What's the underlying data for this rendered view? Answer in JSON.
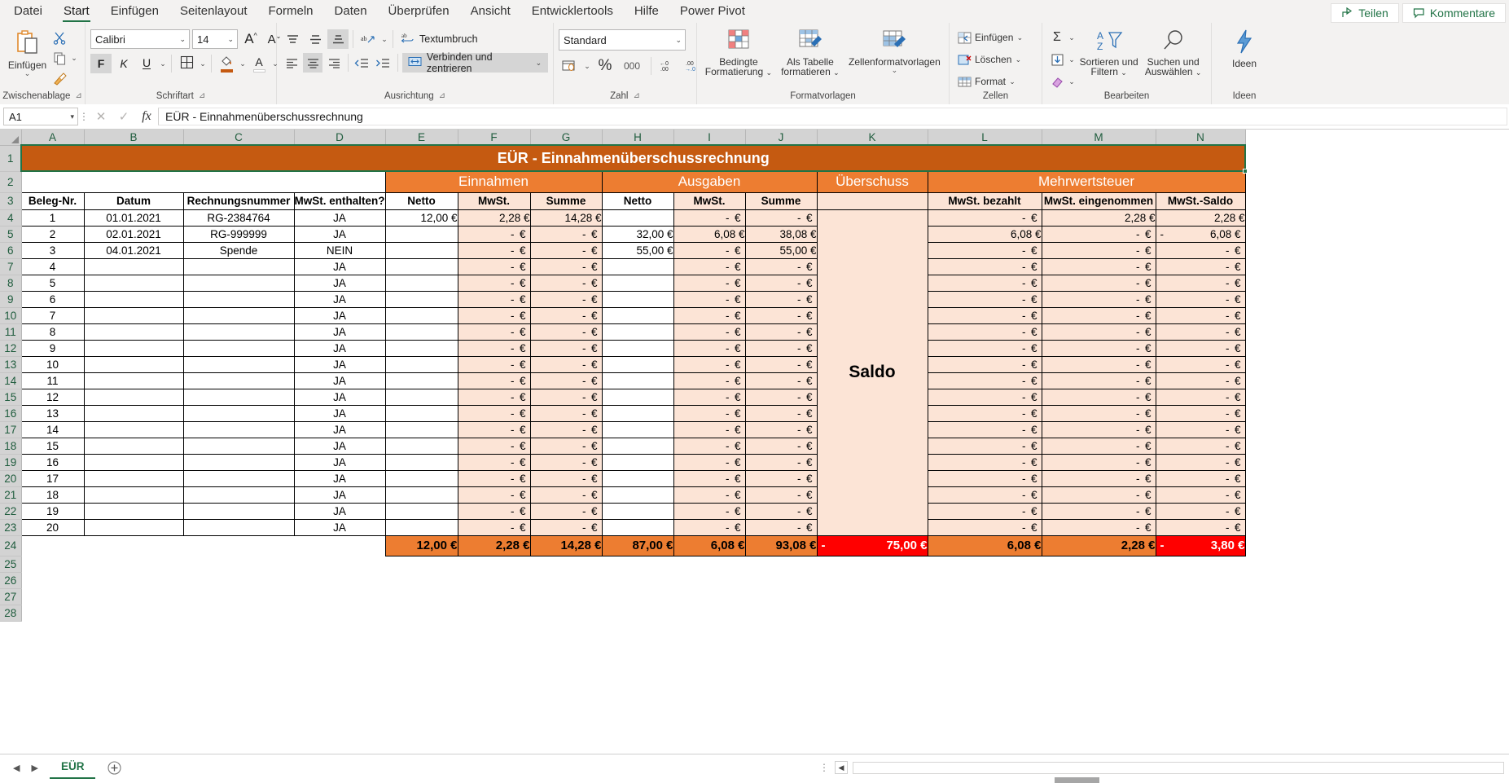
{
  "app": {
    "tabs": [
      "Datei",
      "Start",
      "Einfügen",
      "Seitenlayout",
      "Formeln",
      "Daten",
      "Überprüfen",
      "Ansicht",
      "Entwicklertools",
      "Hilfe",
      "Power Pivot"
    ],
    "active_tab": "Start",
    "share_label": "Teilen",
    "comment_label": "Kommentare"
  },
  "ribbon": {
    "clipboard": {
      "group_label": "Zwischenablage",
      "paste_label": "Einfügen",
      "cut_name": "cut-icon",
      "copy_name": "copy-icon",
      "format_painter_name": "format-painter-icon"
    },
    "font": {
      "group_label": "Schriftart",
      "font_family": "Calibri",
      "font_size": "14",
      "grow_label": "A",
      "shrink_label": "A",
      "bold_label": "F",
      "italic_label": "K",
      "underline_label": "U",
      "font_color": "#ffffff",
      "fill_color": "#c55a11"
    },
    "alignment": {
      "group_label": "Ausrichtung",
      "wrap_label": "Textumbruch",
      "merge_label": "Verbinden und zentrieren"
    },
    "number": {
      "group_label": "Zahl",
      "format": "Standard",
      "percent_label": "%",
      "thousands_label": "000"
    },
    "styles": {
      "group_label": "Formatvorlagen",
      "conditional_label": "Bedingte\nFormatierung",
      "conditional_line1": "Bedingte",
      "conditional_line2": "Formatierung",
      "table_line1": "Als Tabelle",
      "table_line2": "formatieren",
      "cellstyles_label": "Zellenformatvorlagen"
    },
    "cells": {
      "group_label": "Zellen",
      "insert_label": "Einfügen",
      "delete_label": "Löschen",
      "format_label": "Format"
    },
    "editing": {
      "group_label": "Bearbeiten",
      "autosum_name": "sigma-icon",
      "fill_name": "fill-down-icon",
      "clear_name": "eraser-icon",
      "sort_line1": "Sortieren und",
      "sort_line2": "Filtern",
      "find_line1": "Suchen und",
      "find_line2": "Auswählen"
    },
    "ideas": {
      "group_label": "Ideen",
      "button_label": "Ideen"
    }
  },
  "formula_bar": {
    "name_box": "A1",
    "value": "EÜR - Einnahmenüberschussrechnung",
    "cancel_name": "cancel-icon",
    "confirm_name": "confirm-icon",
    "fx_label": "fx"
  },
  "sheet": {
    "column_headers": [
      "A",
      "B",
      "C",
      "D",
      "E",
      "F",
      "G",
      "H",
      "I",
      "J",
      "K",
      "L",
      "M",
      "N"
    ],
    "row_numbers": [
      "1",
      "2",
      "3",
      "4",
      "5",
      "6",
      "7",
      "8",
      "9",
      "10",
      "11",
      "12",
      "13",
      "14",
      "15",
      "16",
      "17",
      "18",
      "19",
      "20",
      "21",
      "22",
      "23",
      "24",
      "25",
      "26",
      "27",
      "28"
    ],
    "title": "EÜR - Einnahmenüberschussrechnung",
    "group_headers": {
      "einnahmen": "Einnahmen",
      "ausgaben": "Ausgaben",
      "ueberschuss": "Überschuss",
      "mehrwertsteuer": "Mehrwertsteuer"
    },
    "column_labels": {
      "beleg_nr": "Beleg-Nr.",
      "datum": "Datum",
      "rechnungsnummer": "Rechnungsnummer",
      "mwst_enthalten": "MwSt. enthalten?",
      "e_netto": "Netto",
      "e_mwst": "MwSt.",
      "e_summe": "Summe",
      "a_netto": "Netto",
      "a_mwst": "MwSt.",
      "a_summe": "Summe",
      "mwst_bezahlt": "MwSt. bezahlt",
      "mwst_eingenommen": "MwSt. eingenommen",
      "mwst_saldo": "MwSt.-Saldo"
    },
    "saldo_label": "Saldo",
    "empty_euro": "-   €",
    "rows": [
      {
        "nr": "1",
        "datum": "01.01.2021",
        "rechnung": "RG-2384764",
        "mwst": "JA",
        "e_netto": "12,00 €",
        "e_mwst": "2,28 €",
        "e_summe": "14,28 €",
        "a_netto": "",
        "a_mwst": "-   €",
        "a_summe": "-   €",
        "bezahlt": "-   €",
        "eingenommen": "2,28 €",
        "saldo": "2,28 €",
        "saldo_neg": false
      },
      {
        "nr": "2",
        "datum": "02.01.2021",
        "rechnung": "RG-999999",
        "mwst": "JA",
        "e_netto": "",
        "e_mwst": "-   €",
        "e_summe": "-   €",
        "a_netto": "32,00 €",
        "a_mwst": "6,08 €",
        "a_summe": "38,08 €",
        "bezahlt": "6,08 €",
        "eingenommen": "-   €",
        "saldo": "6,08 €",
        "saldo_neg": true
      },
      {
        "nr": "3",
        "datum": "04.01.2021",
        "rechnung": "Spende",
        "mwst": "NEIN",
        "e_netto": "",
        "e_mwst": "-   €",
        "e_summe": "-   €",
        "a_netto": "55,00 €",
        "a_mwst": "-   €",
        "a_summe": "55,00 €",
        "bezahlt": "-   €",
        "eingenommen": "-   €",
        "saldo": "-   €",
        "saldo_neg": false
      },
      {
        "nr": "4",
        "datum": "",
        "rechnung": "",
        "mwst": "JA",
        "e_netto": "",
        "e_mwst": "-   €",
        "e_summe": "-   €",
        "a_netto": "",
        "a_mwst": "-   €",
        "a_summe": "-   €",
        "bezahlt": "-   €",
        "eingenommen": "-   €",
        "saldo": "-   €",
        "saldo_neg": false
      },
      {
        "nr": "5",
        "datum": "",
        "rechnung": "",
        "mwst": "JA",
        "e_netto": "",
        "e_mwst": "-   €",
        "e_summe": "-   €",
        "a_netto": "",
        "a_mwst": "-   €",
        "a_summe": "-   €",
        "bezahlt": "-   €",
        "eingenommen": "-   €",
        "saldo": "-   €",
        "saldo_neg": false
      },
      {
        "nr": "6",
        "datum": "",
        "rechnung": "",
        "mwst": "JA",
        "e_netto": "",
        "e_mwst": "-   €",
        "e_summe": "-   €",
        "a_netto": "",
        "a_mwst": "-   €",
        "a_summe": "-   €",
        "bezahlt": "-   €",
        "eingenommen": "-   €",
        "saldo": "-   €",
        "saldo_neg": false
      },
      {
        "nr": "7",
        "datum": "",
        "rechnung": "",
        "mwst": "JA",
        "e_netto": "",
        "e_mwst": "-   €",
        "e_summe": "-   €",
        "a_netto": "",
        "a_mwst": "-   €",
        "a_summe": "-   €",
        "bezahlt": "-   €",
        "eingenommen": "-   €",
        "saldo": "-   €",
        "saldo_neg": false
      },
      {
        "nr": "8",
        "datum": "",
        "rechnung": "",
        "mwst": "JA",
        "e_netto": "",
        "e_mwst": "-   €",
        "e_summe": "-   €",
        "a_netto": "",
        "a_mwst": "-   €",
        "a_summe": "-   €",
        "bezahlt": "-   €",
        "eingenommen": "-   €",
        "saldo": "-   €",
        "saldo_neg": false
      },
      {
        "nr": "9",
        "datum": "",
        "rechnung": "",
        "mwst": "JA",
        "e_netto": "",
        "e_mwst": "-   €",
        "e_summe": "-   €",
        "a_netto": "",
        "a_mwst": "-   €",
        "a_summe": "-   €",
        "bezahlt": "-   €",
        "eingenommen": "-   €",
        "saldo": "-   €",
        "saldo_neg": false
      },
      {
        "nr": "10",
        "datum": "",
        "rechnung": "",
        "mwst": "JA",
        "e_netto": "",
        "e_mwst": "-   €",
        "e_summe": "-   €",
        "a_netto": "",
        "a_mwst": "-   €",
        "a_summe": "-   €",
        "bezahlt": "-   €",
        "eingenommen": "-   €",
        "saldo": "-   €",
        "saldo_neg": false
      },
      {
        "nr": "11",
        "datum": "",
        "rechnung": "",
        "mwst": "JA",
        "e_netto": "",
        "e_mwst": "-   €",
        "e_summe": "-   €",
        "a_netto": "",
        "a_mwst": "-   €",
        "a_summe": "-   €",
        "bezahlt": "-   €",
        "eingenommen": "-   €",
        "saldo": "-   €",
        "saldo_neg": false
      },
      {
        "nr": "12",
        "datum": "",
        "rechnung": "",
        "mwst": "JA",
        "e_netto": "",
        "e_mwst": "-   €",
        "e_summe": "-   €",
        "a_netto": "",
        "a_mwst": "-   €",
        "a_summe": "-   €",
        "bezahlt": "-   €",
        "eingenommen": "-   €",
        "saldo": "-   €",
        "saldo_neg": false
      },
      {
        "nr": "13",
        "datum": "",
        "rechnung": "",
        "mwst": "JA",
        "e_netto": "",
        "e_mwst": "-   €",
        "e_summe": "-   €",
        "a_netto": "",
        "a_mwst": "-   €",
        "a_summe": "-   €",
        "bezahlt": "-   €",
        "eingenommen": "-   €",
        "saldo": "-   €",
        "saldo_neg": false
      },
      {
        "nr": "14",
        "datum": "",
        "rechnung": "",
        "mwst": "JA",
        "e_netto": "",
        "e_mwst": "-   €",
        "e_summe": "-   €",
        "a_netto": "",
        "a_mwst": "-   €",
        "a_summe": "-   €",
        "bezahlt": "-   €",
        "eingenommen": "-   €",
        "saldo": "-   €",
        "saldo_neg": false
      },
      {
        "nr": "15",
        "datum": "",
        "rechnung": "",
        "mwst": "JA",
        "e_netto": "",
        "e_mwst": "-   €",
        "e_summe": "-   €",
        "a_netto": "",
        "a_mwst": "-   €",
        "a_summe": "-   €",
        "bezahlt": "-   €",
        "eingenommen": "-   €",
        "saldo": "-   €",
        "saldo_neg": false
      },
      {
        "nr": "16",
        "datum": "",
        "rechnung": "",
        "mwst": "JA",
        "e_netto": "",
        "e_mwst": "-   €",
        "e_summe": "-   €",
        "a_netto": "",
        "a_mwst": "-   €",
        "a_summe": "-   €",
        "bezahlt": "-   €",
        "eingenommen": "-   €",
        "saldo": "-   €",
        "saldo_neg": false
      },
      {
        "nr": "17",
        "datum": "",
        "rechnung": "",
        "mwst": "JA",
        "e_netto": "",
        "e_mwst": "-   €",
        "e_summe": "-   €",
        "a_netto": "",
        "a_mwst": "-   €",
        "a_summe": "-   €",
        "bezahlt": "-   €",
        "eingenommen": "-   €",
        "saldo": "-   €",
        "saldo_neg": false
      },
      {
        "nr": "18",
        "datum": "",
        "rechnung": "",
        "mwst": "JA",
        "e_netto": "",
        "e_mwst": "-   €",
        "e_summe": "-   €",
        "a_netto": "",
        "a_mwst": "-   €",
        "a_summe": "-   €",
        "bezahlt": "-   €",
        "eingenommen": "-   €",
        "saldo": "-   €",
        "saldo_neg": false
      },
      {
        "nr": "19",
        "datum": "",
        "rechnung": "",
        "mwst": "JA",
        "e_netto": "",
        "e_mwst": "-   €",
        "e_summe": "-   €",
        "a_netto": "",
        "a_mwst": "-   €",
        "a_summe": "-   €",
        "bezahlt": "-   €",
        "eingenommen": "-   €",
        "saldo": "-   €",
        "saldo_neg": false
      },
      {
        "nr": "20",
        "datum": "",
        "rechnung": "",
        "mwst": "JA",
        "e_netto": "",
        "e_mwst": "-   €",
        "e_summe": "-   €",
        "a_netto": "",
        "a_mwst": "-   €",
        "a_summe": "-   €",
        "bezahlt": "-   €",
        "eingenommen": "-   €",
        "saldo": "-   €",
        "saldo_neg": false
      }
    ],
    "totals": {
      "e_netto": "12,00 €",
      "e_mwst": "2,28 €",
      "e_summe": "14,28 €",
      "a_netto": "87,00 €",
      "a_mwst": "6,08 €",
      "a_summe": "93,08 €",
      "ueberschuss": "75,00 €",
      "ueberschuss_sign": "-",
      "bezahlt": "6,08 €",
      "eingenommen": "2,28 €",
      "mwst_saldo": "3,80 €",
      "mwst_saldo_sign": "-"
    },
    "selected_cell": "A1"
  },
  "sheet_tabs": {
    "tabs": [
      "EÜR"
    ],
    "active": "EÜR",
    "add_label": "+"
  },
  "colors": {
    "accent_dark_orange": "#c55a11",
    "accent_orange": "#ed7d31",
    "tint": "#fce4d6",
    "negative_red": "#ff0000",
    "excel_green": "#217346"
  }
}
